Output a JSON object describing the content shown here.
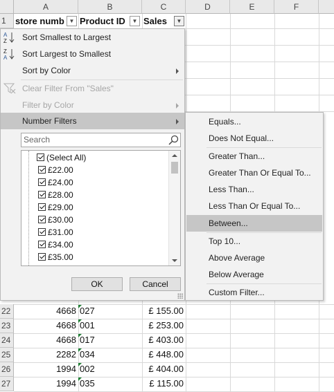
{
  "sheet": {
    "columns": [
      "A",
      "B",
      "C",
      "D",
      "E",
      "F"
    ],
    "header_row_number": "1",
    "headers": [
      "store numb",
      "Product ID",
      "Sales"
    ],
    "dropdown_glyph": "▼",
    "rows": [
      {
        "num": "22",
        "store": "4668",
        "product": "027",
        "sales": "£ 155.00"
      },
      {
        "num": "23",
        "store": "4668",
        "product": "001",
        "sales": "£ 253.00"
      },
      {
        "num": "24",
        "store": "4668",
        "product": "017",
        "sales": "£ 403.00"
      },
      {
        "num": "25",
        "store": "2282",
        "product": "034",
        "sales": "£ 448.00"
      },
      {
        "num": "26",
        "store": "1994",
        "product": "002",
        "sales": "£ 404.00"
      },
      {
        "num": "27",
        "store": "1994",
        "product": "035",
        "sales": "£ 115.00"
      }
    ]
  },
  "filter_menu": {
    "sort_asc": "Sort Smallest to Largest",
    "sort_desc": "Sort Largest to Smallest",
    "sort_color": "Sort by Color",
    "clear_filter": "Clear Filter From \"Sales\"",
    "filter_color": "Filter by Color",
    "number_filters": "Number Filters",
    "icons": {
      "sort_asc": "sort-ascending-icon",
      "sort_desc": "sort-descending-icon",
      "clear": "clear-filter-icon",
      "search": "search-icon"
    },
    "search_placeholder": "Search",
    "list_items": [
      "(Select All)",
      "£22.00",
      "£24.00",
      "£28.00",
      "£29.00",
      "£30.00",
      "£31.00",
      "£34.00",
      "£35.00"
    ],
    "ok_label": "OK",
    "cancel_label": "Cancel"
  },
  "submenu": {
    "items": [
      "Equals...",
      "Does Not Equal...",
      "Greater Than...",
      "Greater Than Or Equal To...",
      "Less Than...",
      "Less Than Or Equal To...",
      "Between...",
      "Top 10...",
      "Above Average",
      "Below Average",
      "Custom Filter..."
    ],
    "highlighted": "Between..."
  },
  "colors": {
    "highlight": "#c6c6c6",
    "menu_bg": "#f2f2f2",
    "header_bg": "#e9e9e9",
    "number_triangle": "#1d7d32"
  }
}
